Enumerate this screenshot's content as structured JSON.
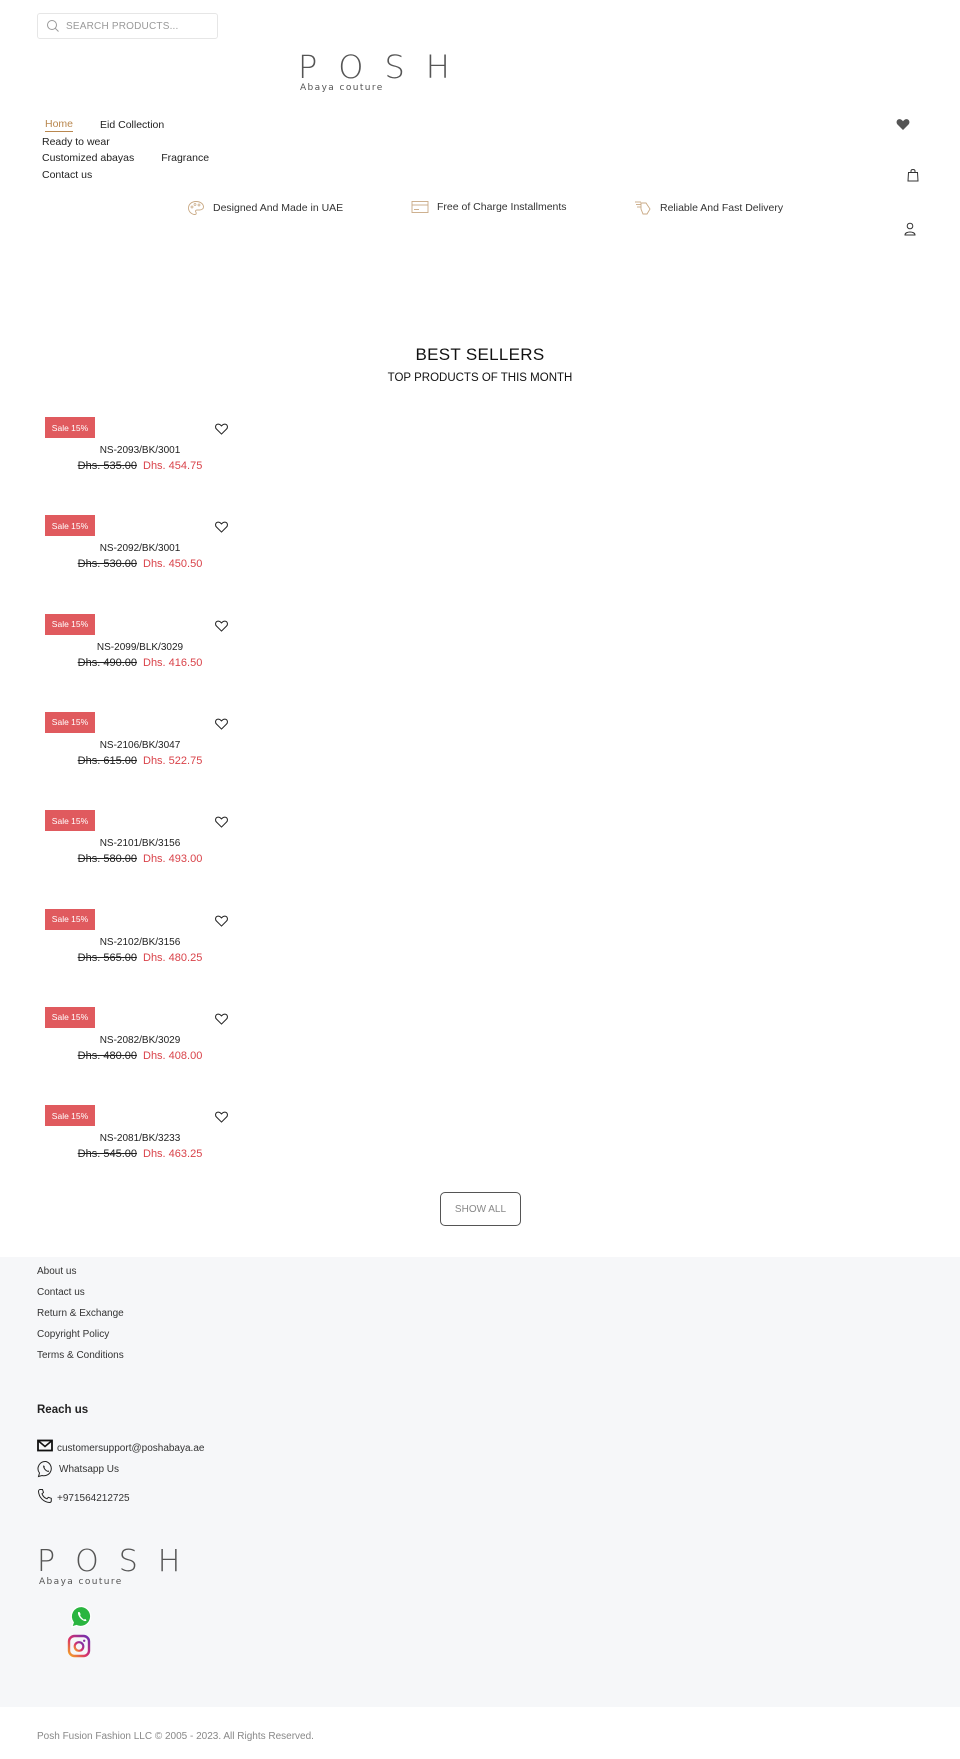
{
  "header": {
    "search": {
      "placeholder": "SEARCH PRODUCTS...",
      "value": "",
      "icon": "search-icon"
    },
    "logo": {
      "main": "POSH",
      "tagline": "Abaya couture"
    },
    "nav": [
      {
        "label": "Home",
        "active": true
      },
      {
        "label": "Eid Collection",
        "active": false
      },
      {
        "label": "Ready to wear",
        "active": false
      },
      {
        "label": "Customized abayas",
        "active": false
      },
      {
        "label": "Fragrance",
        "active": false
      },
      {
        "label": "Contact us",
        "active": false
      }
    ],
    "icons": [
      "heart-icon",
      "shopping-bag-icon",
      "user-icon"
    ],
    "accent_color": "#b9874e"
  },
  "features": [
    {
      "icon": "palette-icon",
      "label": "Designed And Made in UAE"
    },
    {
      "icon": "credit-card-icon",
      "label": "Free of Charge Installments"
    },
    {
      "icon": "delivery-icon",
      "label": "Reliable And Fast Delivery"
    }
  ],
  "best_sellers": {
    "title": "BEST SELLERS",
    "subtitle": "TOP PRODUCTS OF THIS MONTH",
    "badge_color": "#e05a5e",
    "sale_price_color": "#d9434a",
    "products": [
      {
        "badge": "Sale 15%",
        "name": "NS-2093/BK/3001",
        "old_price": "Dhs. 535.00",
        "new_price": "Dhs. 454.75"
      },
      {
        "badge": "Sale 15%",
        "name": "NS-2092/BK/3001",
        "old_price": "Dhs. 530.00",
        "new_price": "Dhs. 450.50"
      },
      {
        "badge": "Sale 15%",
        "name": "NS-2099/BLK/3029",
        "old_price": "Dhs. 490.00",
        "new_price": "Dhs. 416.50"
      },
      {
        "badge": "Sale 15%",
        "name": "NS-2106/BK/3047",
        "old_price": "Dhs. 615.00",
        "new_price": "Dhs. 522.75"
      },
      {
        "badge": "Sale 15%",
        "name": "NS-2101/BK/3156",
        "old_price": "Dhs. 580.00",
        "new_price": "Dhs. 493.00"
      },
      {
        "badge": "Sale 15%",
        "name": "NS-2102/BK/3156",
        "old_price": "Dhs. 565.00",
        "new_price": "Dhs. 480.25"
      },
      {
        "badge": "Sale 15%",
        "name": "NS-2082/BK/3029",
        "old_price": "Dhs. 480.00",
        "new_price": "Dhs. 408.00"
      },
      {
        "badge": "Sale 15%",
        "name": "NS-2081/BK/3233",
        "old_price": "Dhs. 545.00",
        "new_price": "Dhs. 463.25"
      }
    ],
    "show_all_label": "SHOW ALL"
  },
  "footer": {
    "links": [
      "About us",
      "Contact us",
      "Return & Exchange",
      "Copyright Policy",
      "Terms & Conditions"
    ],
    "reach_title": "Reach us",
    "contacts": [
      {
        "icon": "mail-icon",
        "label": "customersupport@poshabaya.ae"
      },
      {
        "icon": "whatsapp-icon",
        "label": "Whatsapp Us"
      },
      {
        "icon": "phone-icon",
        "label": "+971564212725"
      }
    ],
    "logo": {
      "main": "POSH",
      "tagline": "Abaya couture"
    },
    "social": [
      "whatsapp-icon",
      "instagram-icon"
    ],
    "copyright": "Posh Fusion Fashion LLC © 2005 - 2023. All Rights Reserved."
  }
}
